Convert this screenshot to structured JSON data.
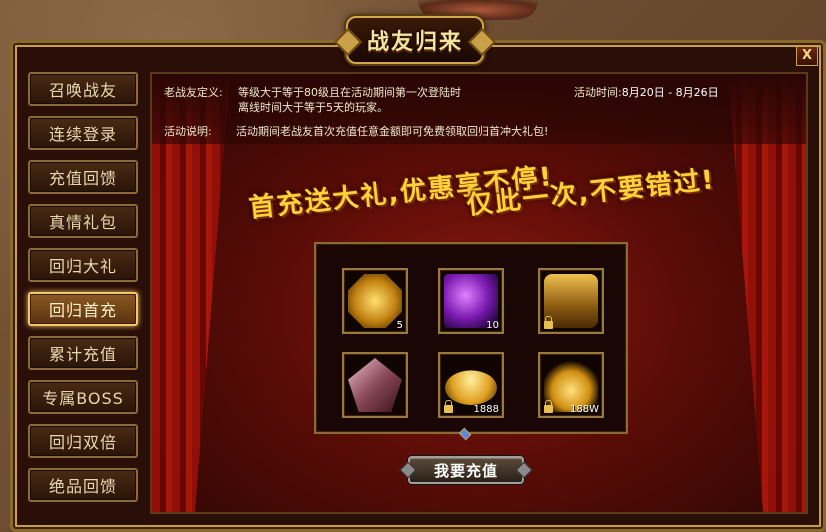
{
  "window": {
    "title": "战友归来",
    "close_label": "X"
  },
  "sidebar": {
    "items": [
      {
        "label": "召唤战友",
        "active": false
      },
      {
        "label": "连续登录",
        "active": false
      },
      {
        "label": "充值回馈",
        "active": false
      },
      {
        "label": "真情礼包",
        "active": false
      },
      {
        "label": "回归大礼",
        "active": false
      },
      {
        "label": "回归首充",
        "active": true
      },
      {
        "label": "累计充值",
        "active": false
      },
      {
        "label": "专属BOSS",
        "active": false
      },
      {
        "label": "回归双倍",
        "active": false
      },
      {
        "label": "绝品回馈",
        "active": false
      }
    ]
  },
  "info": {
    "veteran_label": "老战友定义:",
    "veteran_line1": "等级大于等于80级且在活动期间第一次登陆时",
    "veteran_line2": "离线时间大于等于5天的玩家。",
    "time_label": "活动时间:",
    "time_value": "8月20日 - 8月26日",
    "desc_label": "活动说明:",
    "desc_value": "活动期间老战友首次充值任意金额即可免费领取回归首冲大礼包!"
  },
  "slogan": {
    "line1": "首充送大礼,优惠享不停!",
    "line2": "仅此一次,不要错过!"
  },
  "rewards": [
    {
      "icon": "gold-coin-icon",
      "count": "5",
      "locked": false
    },
    {
      "icon": "purple-gem-icon",
      "count": "10",
      "locked": false
    },
    {
      "icon": "treasure-chest-icon",
      "count": "",
      "locked": true
    },
    {
      "icon": "crystal-ore-icon",
      "count": "",
      "locked": false
    },
    {
      "icon": "gold-ingot-icon",
      "count": "1888",
      "locked": true
    },
    {
      "icon": "gold-coins-pile-icon",
      "count": "188W",
      "locked": true
    }
  ],
  "action": {
    "recharge_label": "我要充值"
  },
  "colors": {
    "gold": "#c9a048",
    "slogan": "#ffd23a",
    "curtain_red": "#9a1008"
  }
}
